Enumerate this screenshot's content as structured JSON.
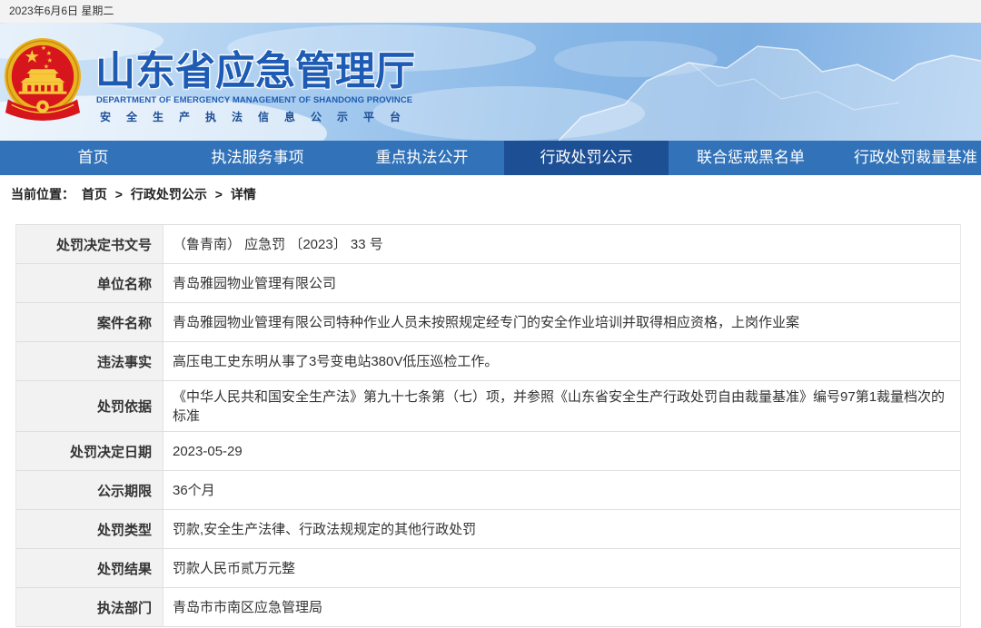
{
  "top_bar": {
    "date": "2023年6月6日 星期二"
  },
  "header": {
    "title": "山东省应急管理厅",
    "subtitle_en": "DEPARTMENT OF EMERGENCY MANAGEMENT OF SHANDONG PROVINCE",
    "platform": "安全生产执法信息公示平台",
    "emblem_icon": "national-emblem-icon"
  },
  "nav": {
    "items": [
      {
        "label": "首页",
        "active": false
      },
      {
        "label": "执法服务事项",
        "active": false
      },
      {
        "label": "重点执法公开",
        "active": false
      },
      {
        "label": "行政处罚公示",
        "active": true
      },
      {
        "label": "联合惩戒黑名单",
        "active": false
      },
      {
        "label": "行政处罚裁量基准",
        "active": false
      }
    ]
  },
  "breadcrumb": {
    "prefix": "当前位置：",
    "separator": ">",
    "items": [
      "首页",
      "行政处罚公示",
      "详情"
    ]
  },
  "detail": {
    "rows": [
      {
        "label": "处罚决定书文号",
        "value": "（鲁青南） 应急罚 〔2023〕 33 号"
      },
      {
        "label": "单位名称",
        "value": "青岛雅园物业管理有限公司"
      },
      {
        "label": "案件名称",
        "value": "青岛雅园物业管理有限公司特种作业人员未按照规定经专门的安全作业培训并取得相应资格，上岗作业案"
      },
      {
        "label": "违法事实",
        "value": "高压电工史东明从事了3号变电站380V低压巡检工作。"
      },
      {
        "label": "处罚依据",
        "value": "《中华人民共和国安全生产法》第九十七条第（七）项，并参照《山东省安全生产行政处罚自由裁量基准》编号97第1裁量档次的标准"
      },
      {
        "label": "处罚决定日期",
        "value": "2023-05-29"
      },
      {
        "label": "公示期限",
        "value": "36个月"
      },
      {
        "label": "处罚类型",
        "value": "罚款,安全生产法律、行政法规规定的其他行政处罚"
      },
      {
        "label": "处罚结果",
        "value": "罚款人民币贰万元整"
      },
      {
        "label": "执法部门",
        "value": "青岛市市南区应急管理局"
      }
    ]
  },
  "colors": {
    "nav_bg": "#3172b9",
    "nav_active_bg": "#1d4f95",
    "title_blue": "#1d5bb4",
    "platform_blue": "#1d4f95",
    "emblem_red": "#d6161c",
    "emblem_gold": "#f2c12e",
    "label_bg": "#f2f2f2"
  }
}
